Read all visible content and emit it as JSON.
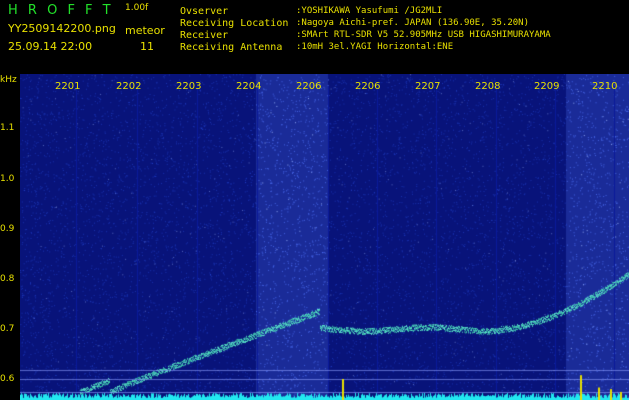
{
  "header": {
    "title": "H R O F F T",
    "version": "1.00f",
    "filename": "YY2509142200.png",
    "datetime": "25.09.14 22:00",
    "mode_label": "meteor",
    "meteor_count": "11",
    "info_labels": [
      "Ovserver",
      "Receiving Location",
      "Receiver",
      "Receiving Antenna"
    ],
    "info_values": [
      ":YOSHIKAWA Yasufumi /JG2MLI",
      ":Nagoya Aichi-pref. JAPAN (136.90E, 35.20N)",
      ":SMArt RTL-SDR V5 52.905MHz USB HIGASHIMURAYAMA",
      ":10mH 3el.YAGI Horizontal:ENE"
    ]
  },
  "axis": {
    "unit": "kHz",
    "y_ticks": [
      "1.1",
      "1.0",
      "0.9",
      "0.8",
      "0.7",
      "0.6"
    ],
    "minutes": [
      "2201",
      "2202",
      "2203",
      "2204",
      "2206",
      "2206",
      "2207",
      "2208",
      "2209",
      "2210"
    ]
  },
  "colors": {
    "background": "#08137a",
    "noise": "#2a4fe0",
    "highlight_band": "#2a3fb0",
    "trace": "#5fe8d0",
    "baseline": "#22e8f0",
    "spike": "#e8e000",
    "text_green": "#22e02a",
    "text_yellow": "#e8e000"
  }
}
